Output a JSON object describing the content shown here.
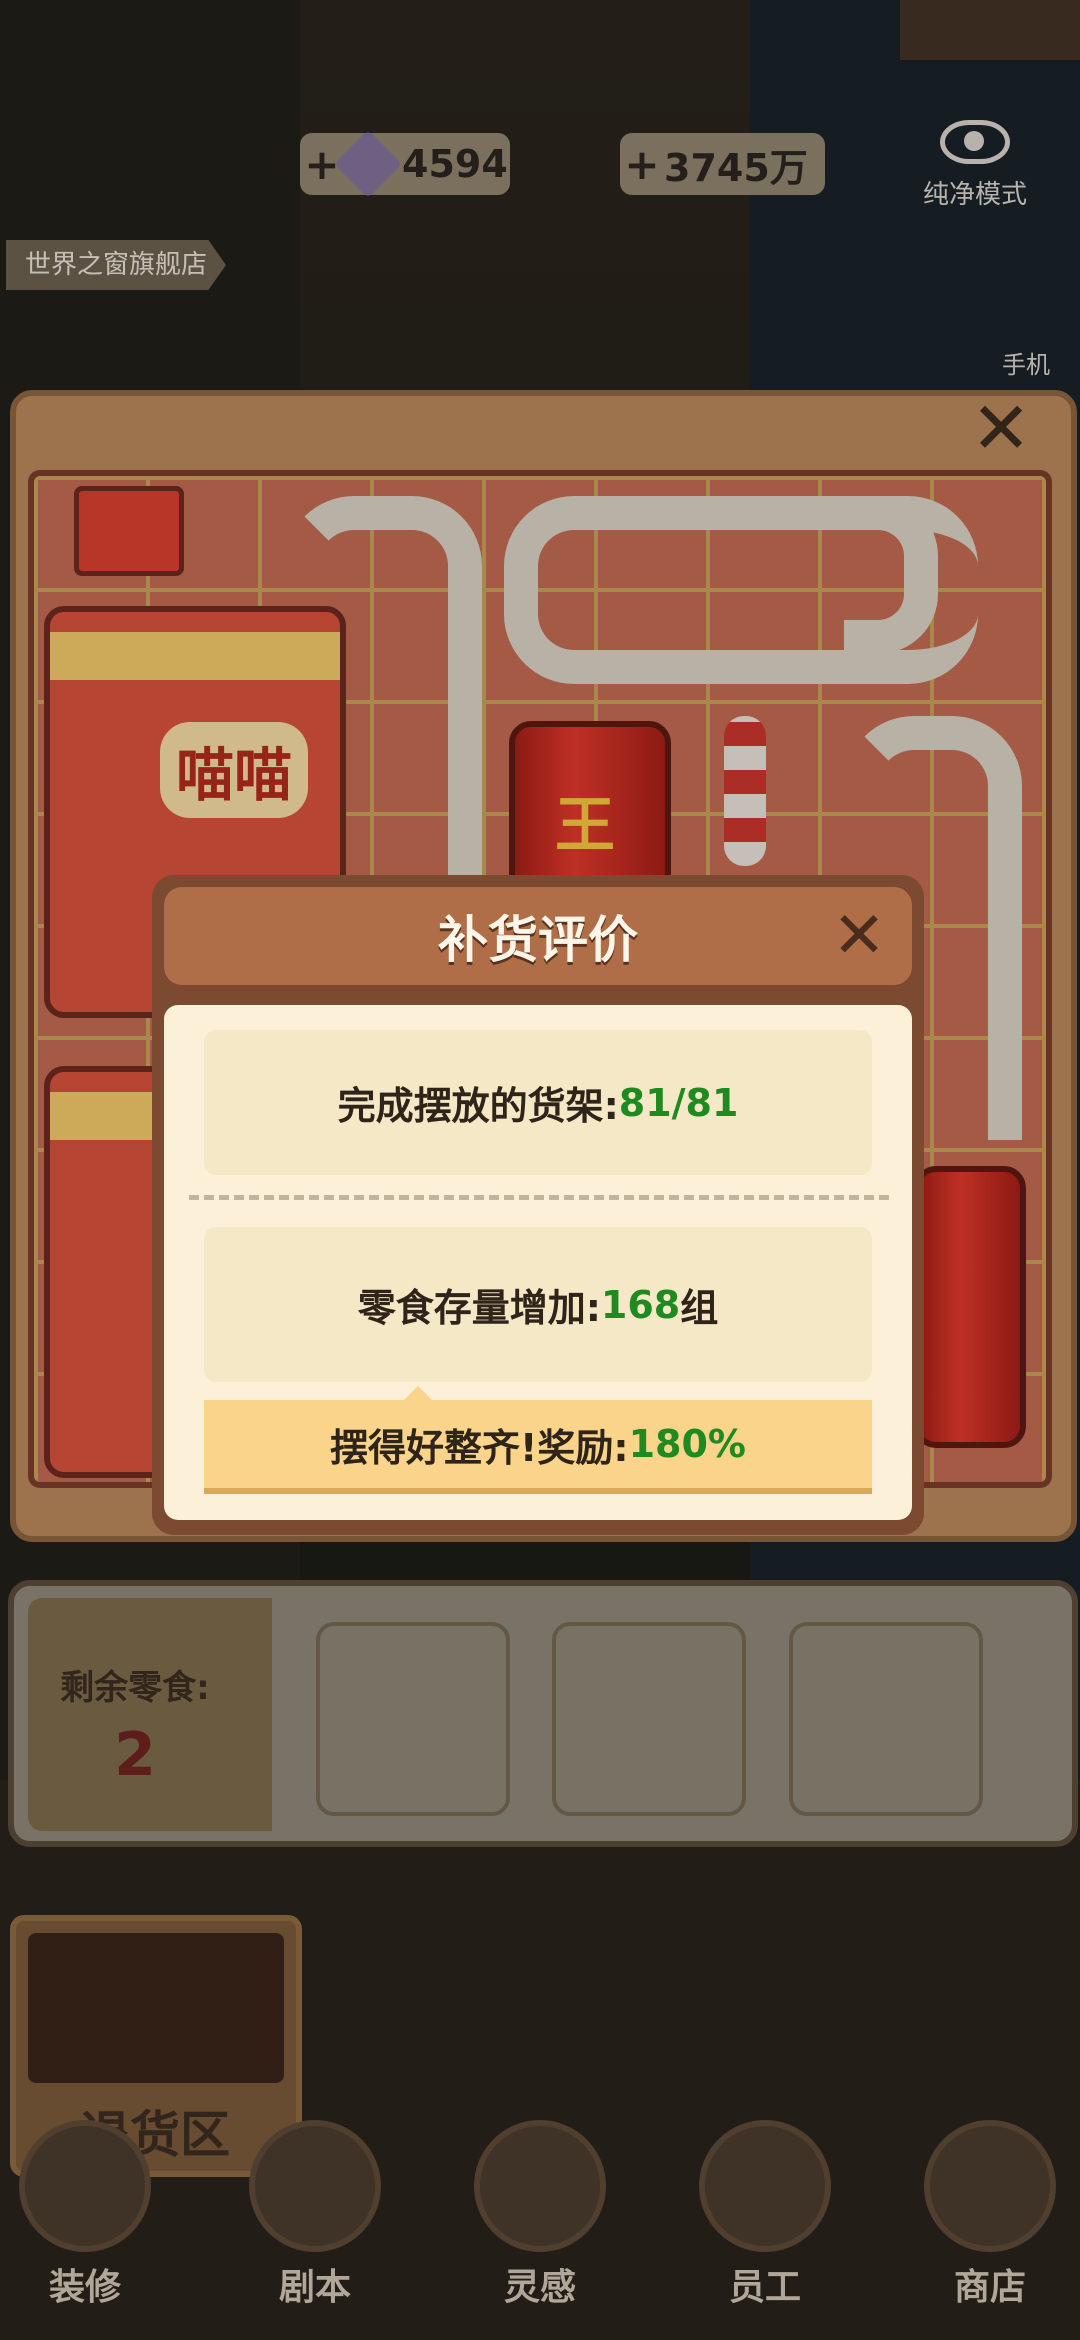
{
  "hud": {
    "gems": "4594",
    "coins": "3745万",
    "plus": "+",
    "pure_mode": "纯净模式",
    "phone": "手机",
    "store_name": "世界之窗旗舰店"
  },
  "board": {
    "close": "✕",
    "chips_label": "喵喵",
    "can_label": "王老吉"
  },
  "tray": {
    "remaining_label": "剩余零食:",
    "remaining_count": "2"
  },
  "return_zone": {
    "label": "退货区"
  },
  "nav": [
    {
      "label": "装修"
    },
    {
      "label": "剧本"
    },
    {
      "label": "灵感"
    },
    {
      "label": "员工"
    },
    {
      "label": "商店"
    }
  ],
  "modal": {
    "title": "补货评价",
    "close": "✕",
    "shelves_label": "完成摆放的货架:",
    "shelves_value": "81/81",
    "snack_label": "零食存量增加:",
    "snack_value": "168",
    "snack_unit": "组",
    "bonus_label": "摆得好整齐!奖励:",
    "bonus_value": "180%"
  },
  "colors": {
    "accent_green": "#1f8a1f",
    "modal_header": "#b06e48",
    "paper": "#fcf1d8"
  }
}
